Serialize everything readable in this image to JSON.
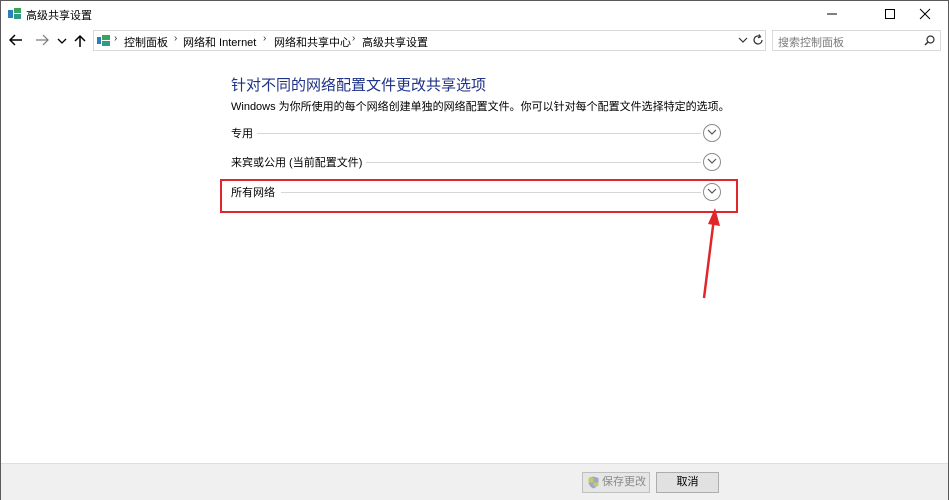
{
  "window": {
    "title": "高级共享设置"
  },
  "nav": {
    "breadcrumb": [
      "控制面板",
      "网络和 Internet",
      "网络和共享中心",
      "高级共享设置"
    ],
    "search_placeholder": "搜索控制面板"
  },
  "main": {
    "heading": "针对不同的网络配置文件更改共享选项",
    "description": "Windows 为你所使用的每个网络创建单独的网络配置文件。你可以针对每个配置文件选择特定的选项。",
    "sections": [
      {
        "label": "专用"
      },
      {
        "label": "来宾或公用 (当前配置文件)"
      },
      {
        "label": "所有网络"
      }
    ]
  },
  "footer": {
    "save_label": "保存更改",
    "cancel_label": "取消"
  },
  "colors": {
    "heading": "#1e3287",
    "annotation": "#e0262b"
  }
}
